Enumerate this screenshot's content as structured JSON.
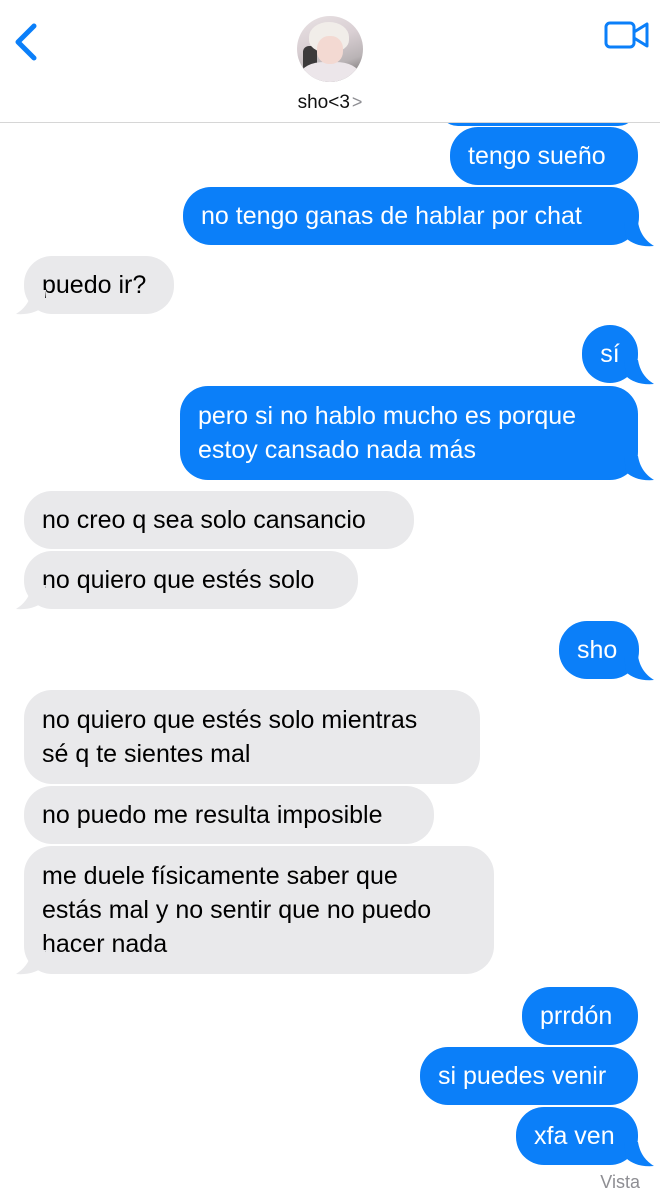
{
  "header": {
    "back_icon": "chevron-left-icon",
    "contact_name": "sho<3",
    "contact_chevron": ">",
    "video_icon": "video-camera-icon",
    "accent_color": "#0b7ff9"
  },
  "messages": [
    {
      "side": "out",
      "text": "tengo sueño"
    },
    {
      "side": "out",
      "text": "no tengo ganas de hablar por chat"
    },
    {
      "side": "in",
      "text": "puedo ir?"
    },
    {
      "side": "out",
      "text": "sí"
    },
    {
      "side": "out",
      "text": "pero si no hablo mucho es porque\nestoy cansado nada más"
    },
    {
      "side": "in",
      "text": "no creo q sea solo cansancio"
    },
    {
      "side": "in",
      "text": "no quiero que estés solo"
    },
    {
      "side": "out",
      "text": "sho"
    },
    {
      "side": "in",
      "text": "no quiero que estés solo mientras\nsé q te sientes mal"
    },
    {
      "side": "in",
      "text": "no puedo me resulta imposible"
    },
    {
      "side": "in",
      "text": "me duele físicamente saber que\nestás mal y no sentir que no puedo\nhacer nada"
    },
    {
      "side": "out",
      "text": "prrdón"
    },
    {
      "side": "out",
      "text": "si puedes venir"
    },
    {
      "side": "out",
      "text": "xfa ven"
    }
  ],
  "status": {
    "read_label": "Vista"
  },
  "colors": {
    "outgoing": "#0b7ff9",
    "incoming": "#e9e9eb"
  }
}
